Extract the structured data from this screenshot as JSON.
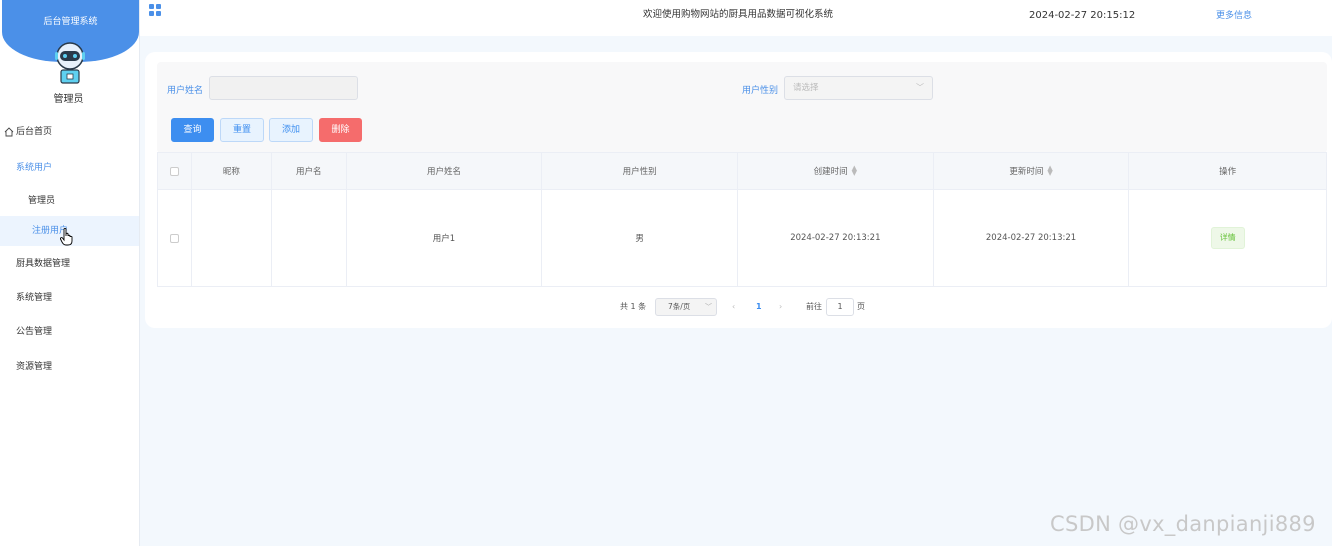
{
  "sidebar": {
    "system_title": "后台管理系统",
    "role_label": "管理员",
    "items": [
      {
        "label": "后台首页"
      },
      {
        "label": "系统用户"
      },
      {
        "label": "管理员"
      },
      {
        "label": "注册用户"
      },
      {
        "label": "厨具数据管理"
      },
      {
        "label": "系统管理"
      },
      {
        "label": "公告管理"
      },
      {
        "label": "资源管理"
      }
    ]
  },
  "header": {
    "menu_icon": "grid-icon",
    "welcome": "欢迎使用购物网站的厨具用品数据可视化系统",
    "datetime": "2024-02-27 20:15:12",
    "more": "更多信息"
  },
  "search": {
    "name_label": "用户姓名",
    "name_value": "",
    "gender_label": "用户性别",
    "gender_placeholder": "请选择"
  },
  "buttons": {
    "query": "查询",
    "reset": "重置",
    "add": "添加",
    "delete": "删除"
  },
  "table": {
    "columns": [
      "昵称",
      "用户名",
      "用户姓名",
      "用户性别",
      "创建时间",
      "更新时间",
      "操作"
    ],
    "rows": [
      {
        "nickname": "",
        "username": "",
        "name": "用户1",
        "gender": "男",
        "created": "2024-02-27 20:13:21",
        "updated": "2024-02-27 20:13:21",
        "action": "详情"
      }
    ]
  },
  "pagination": {
    "total": "共 1 条",
    "page_size": "7条/页",
    "current_page": "1",
    "goto_label": "前往",
    "goto_value": "1",
    "page_suffix": "页"
  },
  "watermark": "CSDN @vx_danpianji889"
}
